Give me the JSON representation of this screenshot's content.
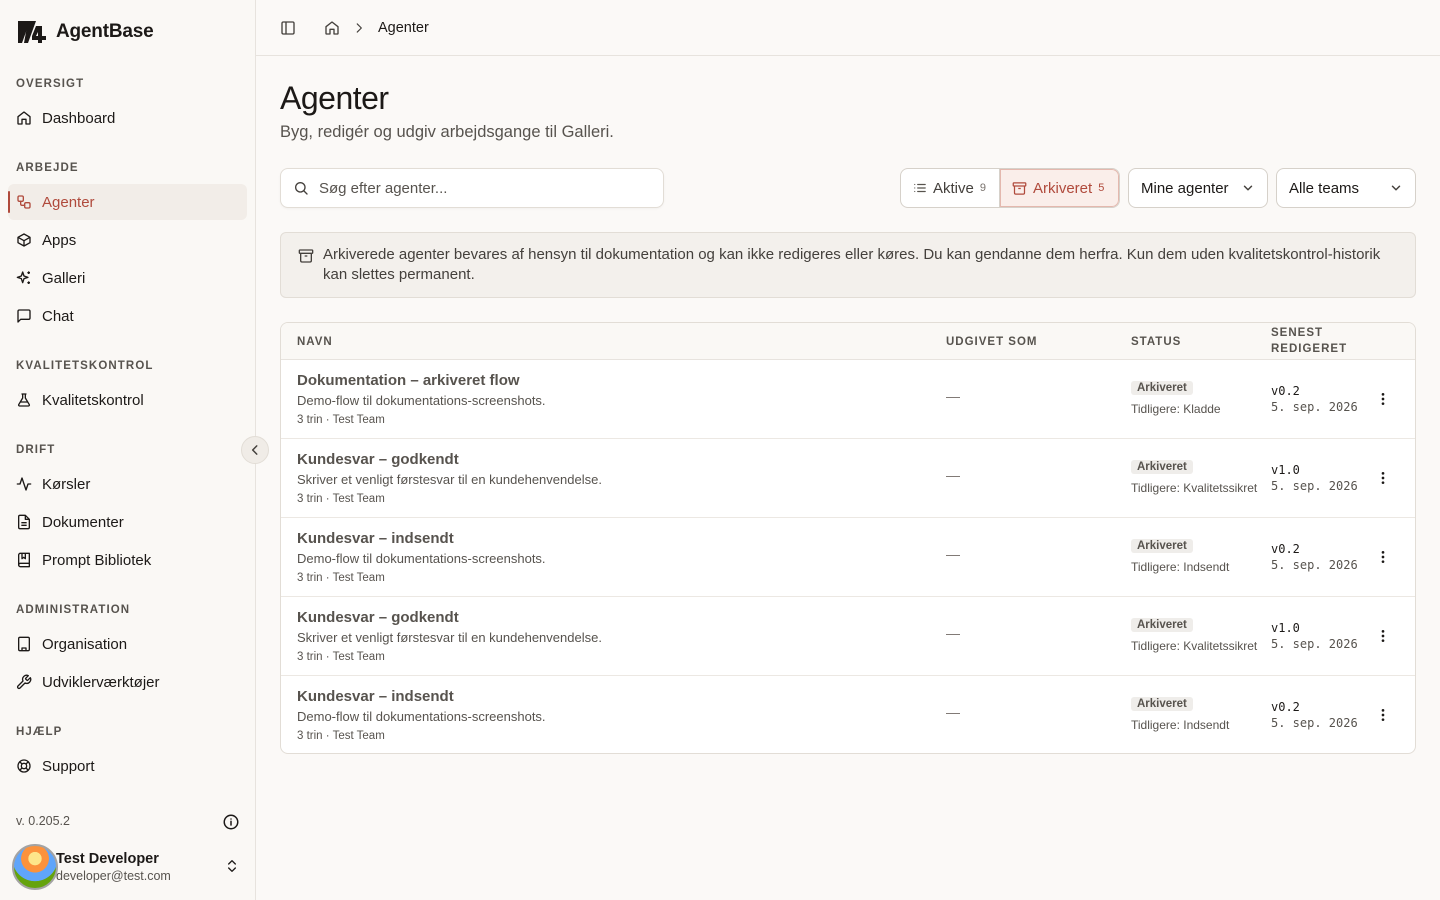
{
  "app": {
    "name": "AgentBase"
  },
  "sidebar": {
    "sections": [
      {
        "label": "OVERSIGT",
        "items": [
          {
            "label": "Dashboard",
            "icon": "home-icon"
          }
        ]
      },
      {
        "label": "ARBEJDE",
        "items": [
          {
            "label": "Agenter",
            "icon": "workflow-icon",
            "active": true
          },
          {
            "label": "Apps",
            "icon": "box-icon"
          },
          {
            "label": "Galleri",
            "icon": "sparkles-icon"
          },
          {
            "label": "Chat",
            "icon": "message-square-icon"
          }
        ]
      },
      {
        "label": "KVALITETSKONTROL",
        "items": [
          {
            "label": "Kvalitetskontrol",
            "icon": "flask-icon"
          }
        ]
      },
      {
        "label": "DRIFT",
        "items": [
          {
            "label": "Kørsler",
            "icon": "activity-icon"
          },
          {
            "label": "Dokumenter",
            "icon": "file-text-icon"
          },
          {
            "label": "Prompt Bibliotek",
            "icon": "book-icon"
          }
        ]
      },
      {
        "label": "ADMINISTRATION",
        "items": [
          {
            "label": "Organisation",
            "icon": "building-icon"
          },
          {
            "label": "Udviklerværktøjer",
            "icon": "wrench-icon"
          }
        ]
      },
      {
        "label": "HJÆLP",
        "items": [
          {
            "label": "Support",
            "icon": "life-buoy-icon"
          }
        ]
      }
    ],
    "version": "v. 0.205.2",
    "user": {
      "name": "Test Developer",
      "email": "developer@test.com"
    }
  },
  "breadcrumb": {
    "current": "Agenter"
  },
  "page": {
    "title": "Agenter",
    "subtitle": "Byg, redigér og udgiv arbejdsgange til Galleri."
  },
  "search": {
    "placeholder": "Søg efter agenter..."
  },
  "filters": {
    "active_label": "Aktive",
    "active_count": "9",
    "archived_label": "Arkiveret",
    "archived_count": "5",
    "owner_select": "Mine agenter",
    "team_select": "Alle teams"
  },
  "banner": {
    "text": "Arkiverede agenter bevares af hensyn til dokumentation og kan ikke redigeres eller køres. Du kan gendanne dem herfra. Kun dem uden kvalitetskontrol-historik kan slettes permanent."
  },
  "table": {
    "headers": {
      "name": "NAVN",
      "published": "UDGIVET SOM",
      "status": "STATUS",
      "edited_line1": "SENEST",
      "edited_line2": "REDIGERET"
    },
    "rows": [
      {
        "name": "Dokumentation – arkiveret flow",
        "description": "Demo-flow til dokumentations-screenshots.",
        "meta": "3 trin · Test Team",
        "published": "—",
        "status": "Arkiveret",
        "previous": "Tidligere: Kladde",
        "version": "v0.2",
        "date": "5. sep. 2026"
      },
      {
        "name": "Kundesvar – godkendt",
        "description": "Skriver et venligt førstesvar til en kundehenvendelse.",
        "meta": "3 trin · Test Team",
        "published": "—",
        "status": "Arkiveret",
        "previous": "Tidligere: Kvalitetssikret",
        "version": "v1.0",
        "date": "5. sep. 2026"
      },
      {
        "name": "Kundesvar – indsendt",
        "description": "Demo-flow til dokumentations-screenshots.",
        "meta": "3 trin · Test Team",
        "published": "—",
        "status": "Arkiveret",
        "previous": "Tidligere: Indsendt",
        "version": "v0.2",
        "date": "5. sep. 2026"
      },
      {
        "name": "Kundesvar – godkendt",
        "description": "Skriver et venligt førstesvar til en kundehenvendelse.",
        "meta": "3 trin · Test Team",
        "published": "—",
        "status": "Arkiveret",
        "previous": "Tidligere: Kvalitetssikret",
        "version": "v1.0",
        "date": "5. sep. 2026"
      },
      {
        "name": "Kundesvar – indsendt",
        "description": "Demo-flow til dokumentations-screenshots.",
        "meta": "3 trin · Test Team",
        "published": "—",
        "status": "Arkiveret",
        "previous": "Tidligere: Indsendt",
        "version": "v0.2",
        "date": "5. sep. 2026"
      }
    ]
  },
  "colors": {
    "accent": "#b04a3c",
    "background": "#fbf9f7"
  }
}
